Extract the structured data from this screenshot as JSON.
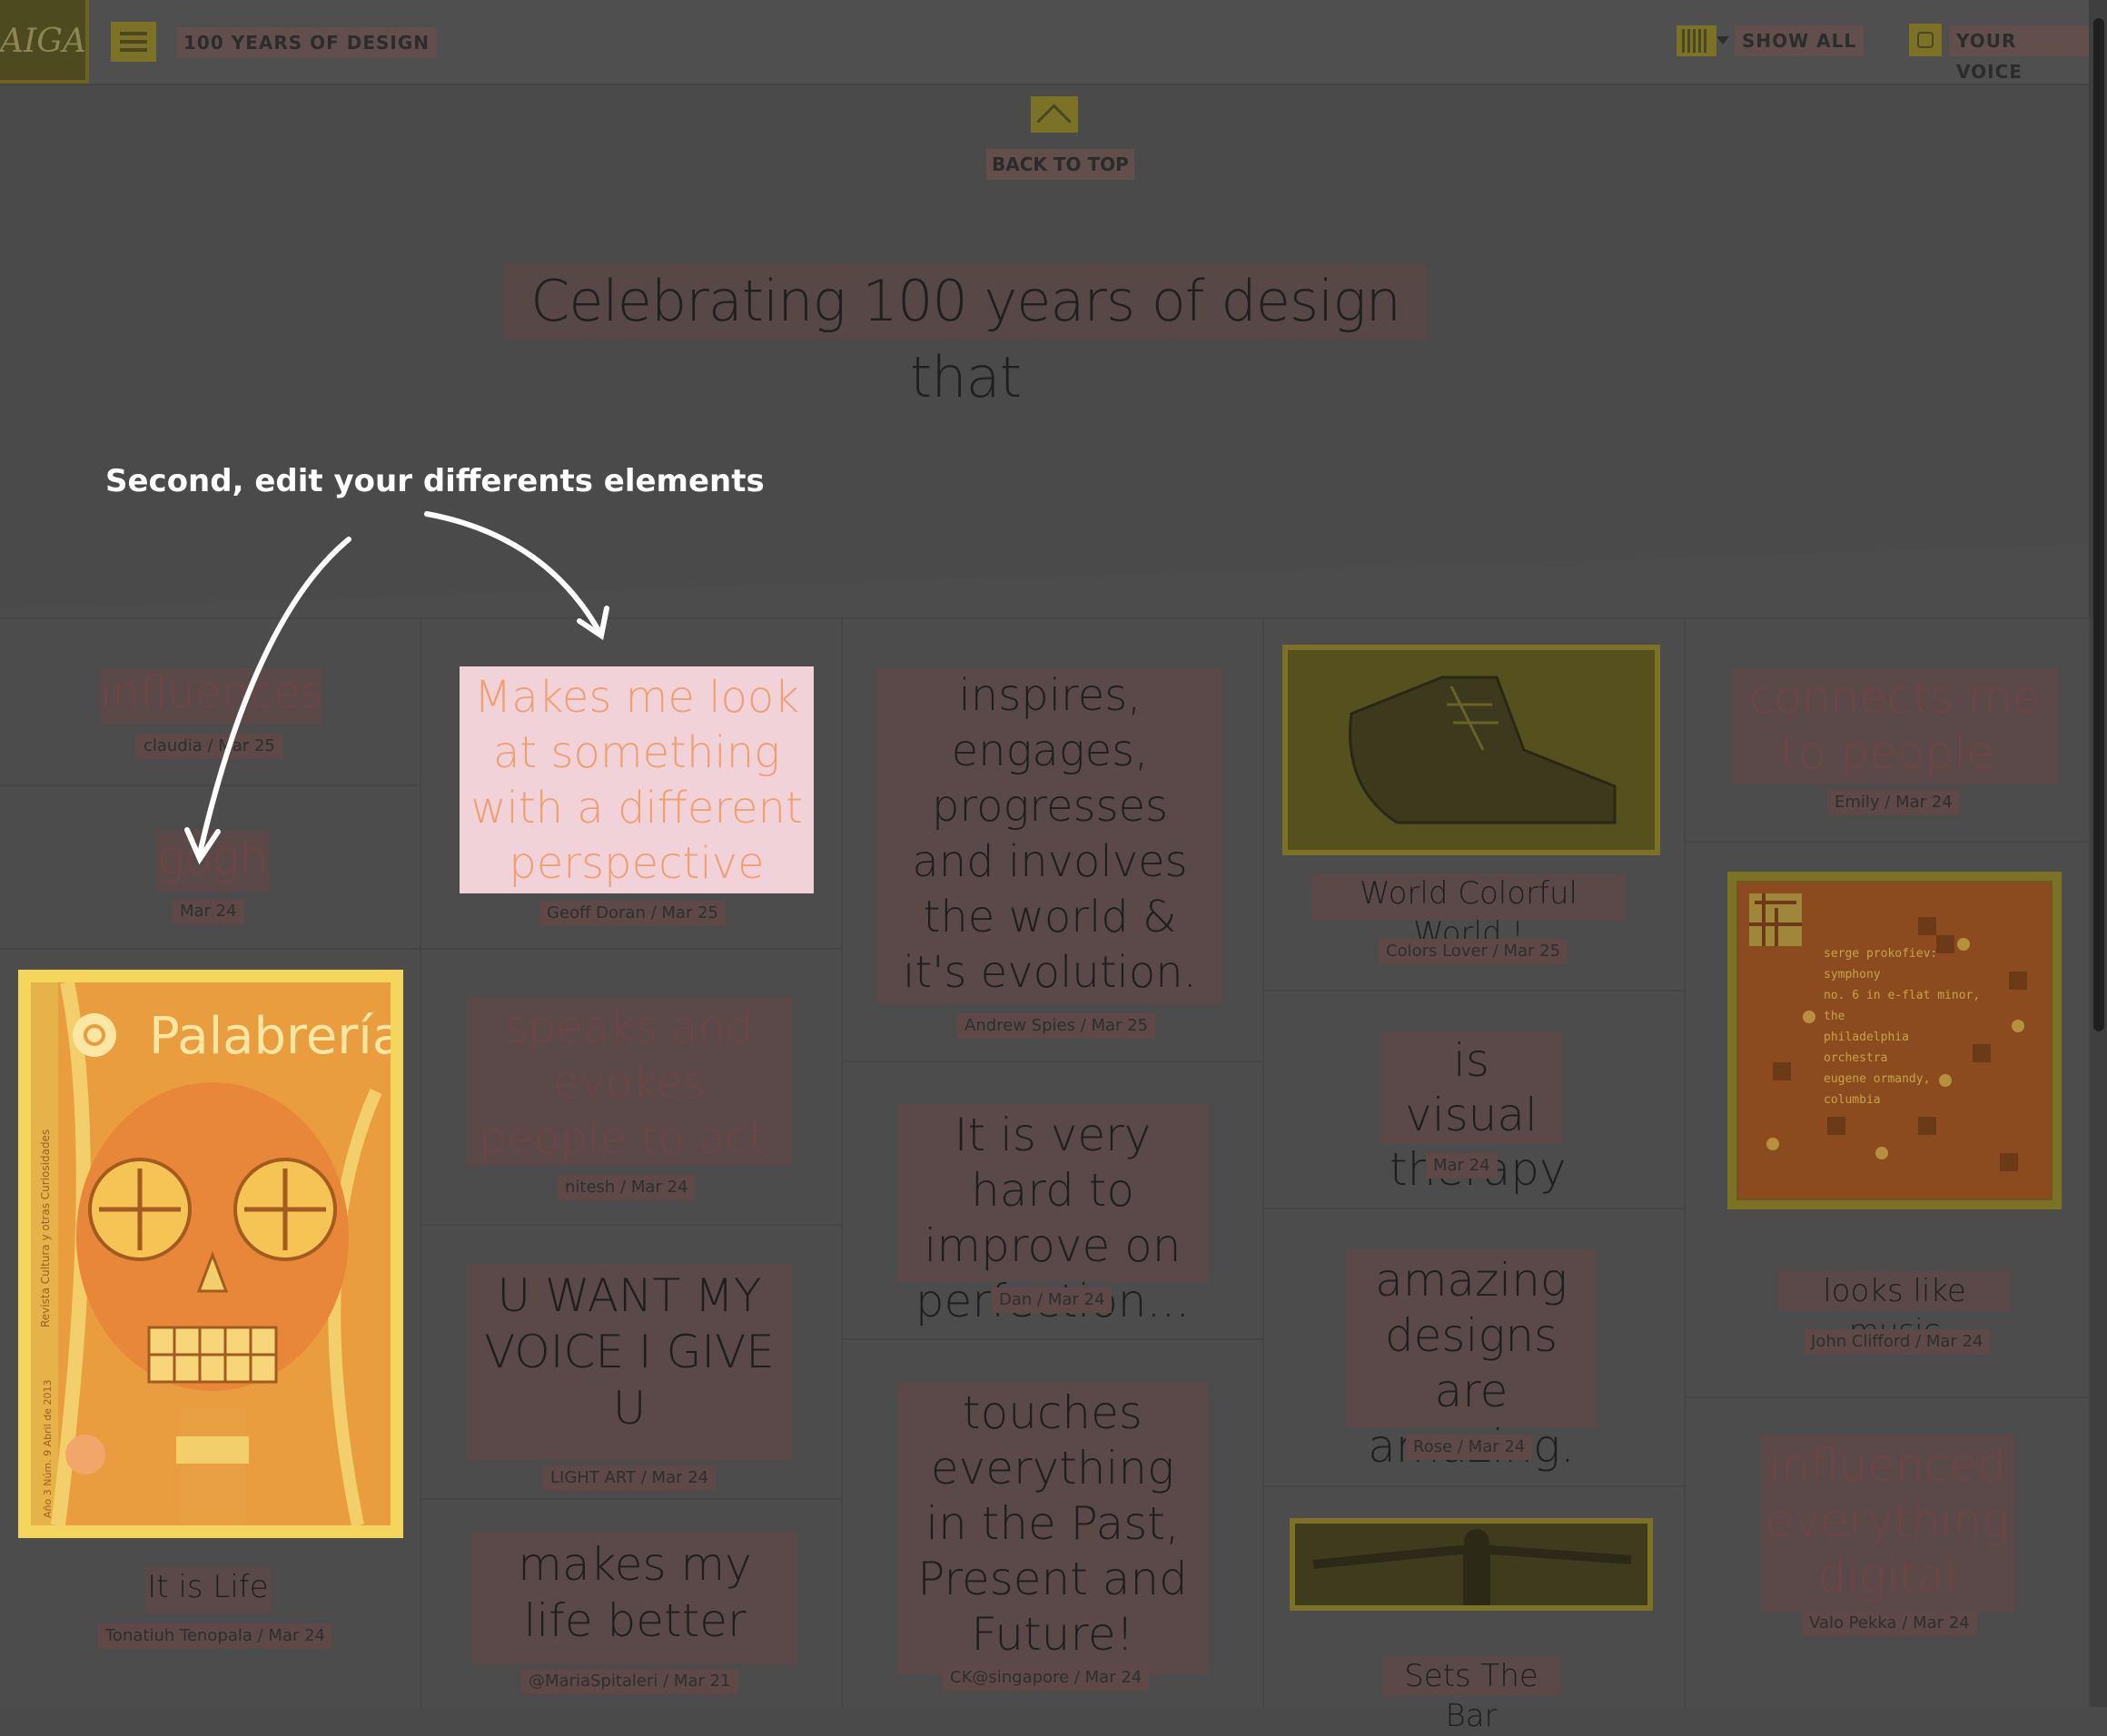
{
  "header": {
    "logo": "AIGA",
    "site_title": "100 YEARS OF DESIGN",
    "show_all": "SHOW ALL",
    "your_voice": "YOUR VOICE"
  },
  "back_to_top": "BACK TO TOP",
  "hero_text": "Celebrating 100 years of design that",
  "tutorial": {
    "caption": "Second, edit your differents elements"
  },
  "cards": {
    "c1a": {
      "text": "influences",
      "author": "claudia / Mar 25"
    },
    "c1b": {
      "text": "gogh",
      "author": "Mar 24"
    },
    "c1c": {
      "image_title": "Palabrería",
      "side_text": "Revista Cultura y otras Curiosidades",
      "issue_text": "Año 3 Núm. 9 Abril de 2013",
      "text": "It is Life",
      "author": "Tonatiuh Tenopala / Mar 24"
    },
    "c2a": {
      "text": "Makes me look at something with a different perspective",
      "author": "Geoff Doran / Mar 25"
    },
    "c2b": {
      "text": "speaks and evokes people to act.",
      "author": "nitesh / Mar 24"
    },
    "c2c": {
      "text": "U WANT MY VOICE I GIVE U",
      "author": "LIGHT ART / Mar 24"
    },
    "c2d": {
      "text": "makes my life better",
      "author": "@MariaSpitaleri / Mar 21"
    },
    "c3a": {
      "text": "inspires, engages, progresses and involves the world & it's evolution.",
      "author": "Andrew Spies / Mar 25"
    },
    "c3b": {
      "text": "It is very hard to improve on perfection...",
      "author": "Dan / Mar 24"
    },
    "c3c": {
      "text": "touches everything in the Past, Present and Future!",
      "author": "CK@singapore / Mar 24"
    },
    "c4a": {
      "text": "World Colorful World !",
      "author": "Colors Lover / Mar 25"
    },
    "c4b": {
      "text": "is visual therapy",
      "author": "Mar 24"
    },
    "c4c": {
      "text": "amazing designs are amazing.",
      "author": "Rose / Mar 24"
    },
    "c4d": {
      "text": "Sets The Bar"
    },
    "c5a": {
      "text": "connects me to people.",
      "author": "Emily / Mar 24"
    },
    "c5b": {
      "album_lines": [
        "serge prokofiev:",
        "symphony",
        "no. 6 in e-flat minor,",
        "the",
        "philadelphia",
        "orchestra",
        "eugene ormandy,",
        "columbia"
      ],
      "text": "looks like music",
      "author": "John Clifford / Mar 24"
    },
    "c5c": {
      "text": "influenced everything digital",
      "author": "Valo Pekka / Mar 24"
    }
  }
}
